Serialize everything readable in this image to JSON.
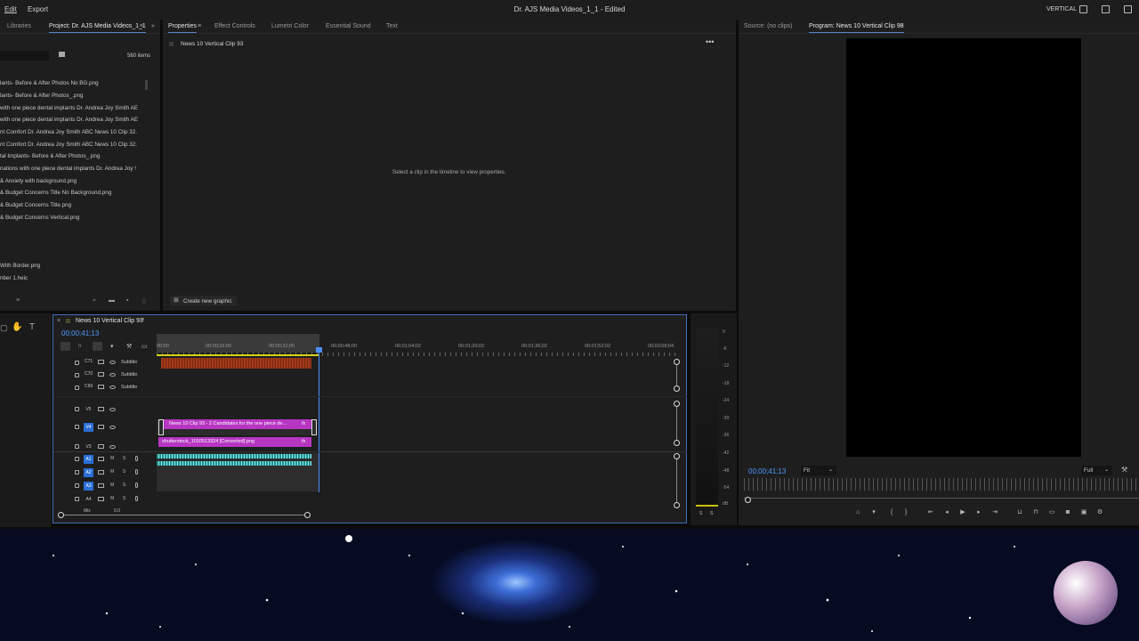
{
  "menu": {
    "edit": "Edit",
    "export": "Export"
  },
  "window_title": "Dr. AJS Media Videos_1_1 - Edited",
  "workspace": "VERTICAL",
  "project_panel": {
    "tab_libraries": "Libraries",
    "tab_project": "Project: Dr. AJS Media Videos_1_1",
    "item_count": "560 items",
    "items": [
      "lants-  Before & After Photos No BG.png",
      "lants-  Before & After Photos_.png",
      "with one piece dental implants Dr. Andrea Joy Smith AE",
      "with one piece dental implants Dr. Andrea Joy Smith AE",
      "nt Comfort Dr. Andrea Joy Smith ABC News 10 Clip 32.",
      "nt Comfort Dr. Andrea Joy Smith ABC News 10 Clip 32.",
      "tal  Implants-  Before & After Photos_.png",
      "nations with one piece dental implants Dr. Andrea Joy !",
      "& Anxiety with background.png",
      "& Budget  Concerns Title No Background.png",
      "& Budget  Concerns Title.png",
      "& Budget  Concerns Vertical.png",
      "With Border.png",
      "nber 1.heic"
    ]
  },
  "properties_panel": {
    "tabs": [
      "Properties",
      "Effect Controls",
      "Lumetri Color",
      "Essential Sound",
      "Text"
    ],
    "clip_name": "News 10 Vertical Clip 93",
    "empty_message": "Select a clip in the timeline to view properties.",
    "create_graphic": "Create new graphic"
  },
  "program_panel": {
    "tab_source": "Source: (no clips)",
    "tab_program": "Program: News 10 Vertical Clip 93",
    "timecode": "00;00;41;13",
    "fit": "Fit",
    "quality": "Full"
  },
  "timeline": {
    "sequence_name": "News 10 Vertical Clip 93",
    "timecode": "00;00;41;13",
    "ruler": [
      "00;00",
      "00;00;16;00",
      "00;00;32;00",
      "00;00;48;00",
      "00;01;04;02",
      "00;01;20;02",
      "00;01;36;02",
      "00;01;52;02",
      "00;02;08;04"
    ],
    "caption_tracks": [
      {
        "name": "C71",
        "label": "Subtitle"
      },
      {
        "name": "C70",
        "label": "Subtitle"
      },
      {
        "name": "C69",
        "label": "Subtitle"
      }
    ],
    "video_tracks": [
      "V5",
      "V4",
      "V3"
    ],
    "audio_tracks": [
      "A1",
      "A2",
      "A3",
      "A4"
    ],
    "audio_m": "M",
    "audio_s": "S",
    "mix_label": "Mix",
    "mix_value": "0.0",
    "clip_v4": "News 10 Clip 93 -  2 Candidates for the one piece de...",
    "clip_v3": "shutterstock_1010513324 [Converted].png",
    "fx": "fx"
  },
  "audio_meter": {
    "labels": [
      "0",
      "-6",
      "-12",
      "-18",
      "-24",
      "-30",
      "-36",
      "-42",
      "-48",
      "-54",
      "dB"
    ],
    "solo": "S",
    "solo2": "S"
  },
  "colors": {
    "accent_blue": "#4d9bff",
    "clip_magenta": "#b636c2",
    "caption_clip": "#a0391a",
    "audio_clip": "#1b8f8f"
  }
}
